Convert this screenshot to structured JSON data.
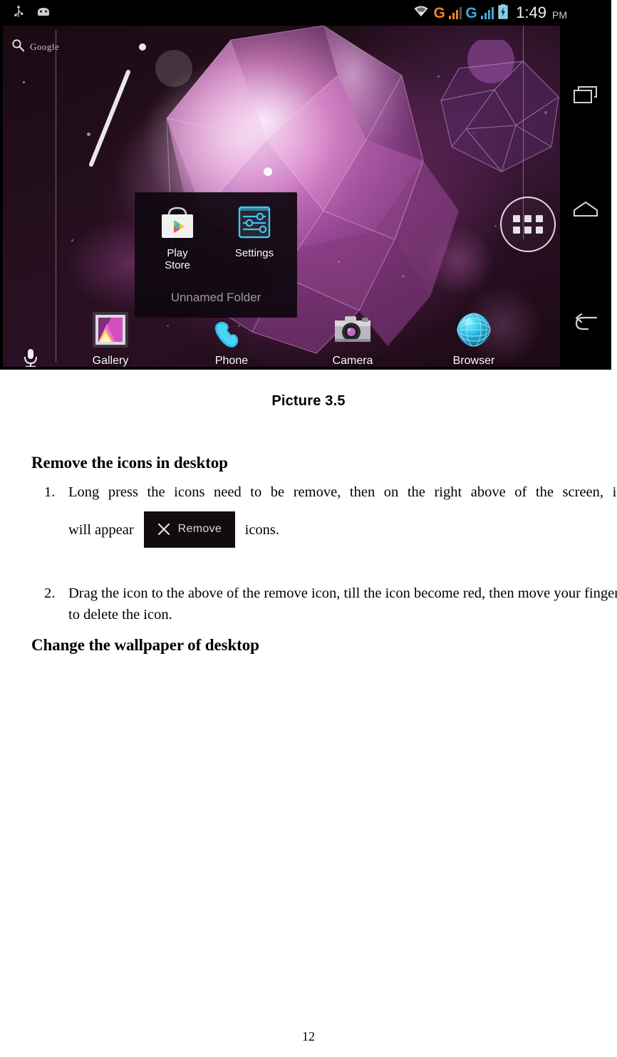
{
  "screenshot": {
    "statusbar": {
      "left_icons": [
        "usb-icon",
        "android-debug-icon"
      ],
      "wifi_icon": "wifi-icon",
      "network1_label": "G",
      "network1_color": "#f08224",
      "network2_label": "G",
      "network2_color": "#3fa9dd",
      "battery_icon": "battery-charging-icon",
      "time": "1:49",
      "meridiem": "PM"
    },
    "search_widget": {
      "icon": "search-icon",
      "label": "Google",
      "mic_icon": "microphone-icon"
    },
    "app_drawer": {
      "icon": "apps-grid-icon"
    },
    "folder": {
      "name": "Unnamed Folder",
      "apps": [
        {
          "label": "Play Store",
          "icon": "play-store-icon"
        },
        {
          "label": "Settings",
          "icon": "settings-sliders-icon"
        }
      ]
    },
    "dock": [
      {
        "label": "Gallery",
        "icon": "gallery-icon"
      },
      {
        "label": "Phone",
        "icon": "phone-handset-icon"
      },
      {
        "label": "Camera",
        "icon": "camera-icon"
      },
      {
        "label": "Browser",
        "icon": "browser-globe-icon"
      }
    ],
    "navbar": [
      {
        "name": "recents",
        "icon": "recents-icon"
      },
      {
        "name": "home",
        "icon": "home-icon"
      },
      {
        "name": "back",
        "icon": "back-arrow-icon"
      }
    ]
  },
  "document": {
    "caption": "Picture 3.5",
    "heading_remove": "Remove the icons in desktop",
    "heading_wallpaper": "Change the wallpaper of desktop",
    "steps": [
      {
        "number": "1.",
        "text_before": "Long press the icons need to be remove, then on the right above of the screen, it",
        "text_lead": "will appear",
        "badge_label": "Remove",
        "badge_icon": "close-x-icon",
        "text_after": "icons."
      },
      {
        "number": "2.",
        "text": "Drag the icon to the above of the remove icon, till the icon become red, then move your finger to delete the icon."
      }
    ],
    "page_number": "12"
  }
}
